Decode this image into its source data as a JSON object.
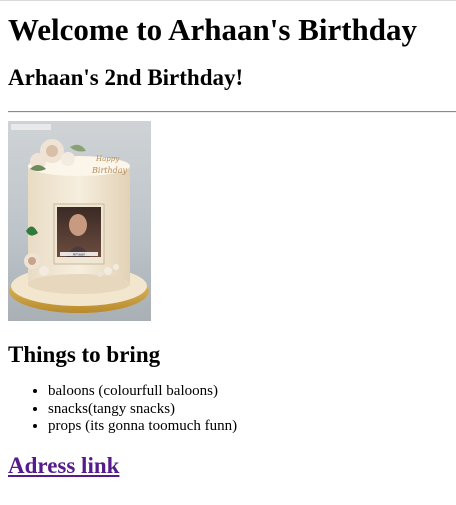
{
  "page": {
    "heading": "Welcome to Arhaan's Birthday",
    "subheading": "Arhaan's 2nd Birthday!"
  },
  "cake_image": {
    "icon": "birthday-cake-photo-image",
    "topper_text": "Happy Birthday",
    "watermark": "Happy Birthday",
    "caption": "Arhaan"
  },
  "things": {
    "heading": "Things to bring",
    "items": [
      "baloons (colourfull baloons)",
      "snacks(tangy snacks)",
      "props (its gonna toomuch funn)"
    ]
  },
  "link": {
    "label": "Adress link",
    "color": "#551a8b"
  }
}
